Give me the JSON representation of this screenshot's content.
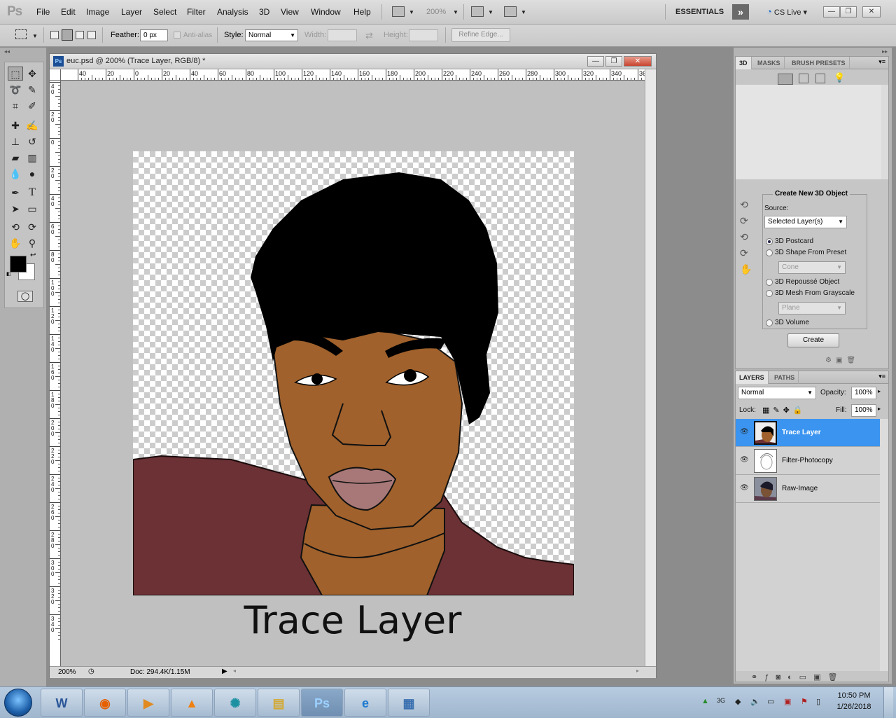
{
  "app": {
    "logo": "Ps"
  },
  "menu": [
    "File",
    "Edit",
    "Image",
    "Layer",
    "Select",
    "Filter",
    "Analysis",
    "3D",
    "View",
    "Window",
    "Help"
  ],
  "toolbar": {
    "zoom": "200%",
    "workspace": "ESSENTIALS",
    "cslive": "CS Live"
  },
  "options": {
    "feather_label": "Feather:",
    "feather_value": "0 px",
    "antialias_label": "Anti-alias",
    "style_label": "Style:",
    "style_value": "Normal",
    "width_label": "Width:",
    "height_label": "Height:",
    "refine_edge": "Refine Edge..."
  },
  "document": {
    "title": "euc.psd @ 200% (Trace Layer, RGB/8) *",
    "caption": "Trace Layer",
    "status_zoom": "200%",
    "status_doc": "Doc: 294.4K/1.15M",
    "hruler_labels": [
      "40",
      "20",
      "0",
      "20",
      "40",
      "60",
      "80",
      "100",
      "120",
      "140",
      "160",
      "180",
      "200",
      "220",
      "240",
      "260",
      "280",
      "300",
      "320",
      "340",
      "360"
    ],
    "vruler_labels": [
      "4 0",
      "2 0",
      "0",
      "2 0",
      "4 0",
      "6 0",
      "8 0",
      "1 0 0",
      "1 2 0",
      "1 4 0",
      "1 6 0",
      "1 8 0",
      "2 0 0",
      "2 2 0",
      "2 4 0",
      "2 6 0",
      "2 8 0",
      "3 0 0",
      "3 2 0",
      "3 4 0"
    ]
  },
  "panel3d": {
    "tabs": [
      "3D",
      "MASKS",
      "BRUSH PRESETS"
    ],
    "group_title": "Create New 3D Object",
    "source_label": "Source:",
    "source_value": "Selected Layer(s)",
    "options": [
      "3D Postcard",
      "3D Shape From Preset",
      "3D Repoussé Object",
      "3D Mesh From Grayscale",
      "3D Volume"
    ],
    "selected_option": "3D Postcard",
    "preset_value": "Cone",
    "mesh_value": "Plane",
    "create_button": "Create"
  },
  "layers": {
    "tabs": [
      "LAYERS",
      "PATHS"
    ],
    "blend_mode": "Normal",
    "opacity_label": "Opacity:",
    "opacity": "100%",
    "lock_label": "Lock:",
    "fill_label": "Fill:",
    "fill": "100%",
    "items": [
      {
        "name": "Trace Layer",
        "selected": true
      },
      {
        "name": "Filter-Photocopy",
        "selected": false
      },
      {
        "name": "Raw-Image",
        "selected": false
      }
    ]
  },
  "taskbar": {
    "apps": [
      "word-icon",
      "firefox-icon",
      "media-player-icon",
      "vlc-icon",
      "reel-icon",
      "explorer-icon",
      "photoshop-icon",
      "internet-explorer-icon",
      "control-panel-icon"
    ],
    "time": "10:50 PM",
    "date": "1/26/2018"
  },
  "colors": {
    "selected_layer": "#3a94f0",
    "skin": "#a0612c",
    "hair": "#000000",
    "shirt": "#6b3135",
    "lips": "#a87878"
  }
}
